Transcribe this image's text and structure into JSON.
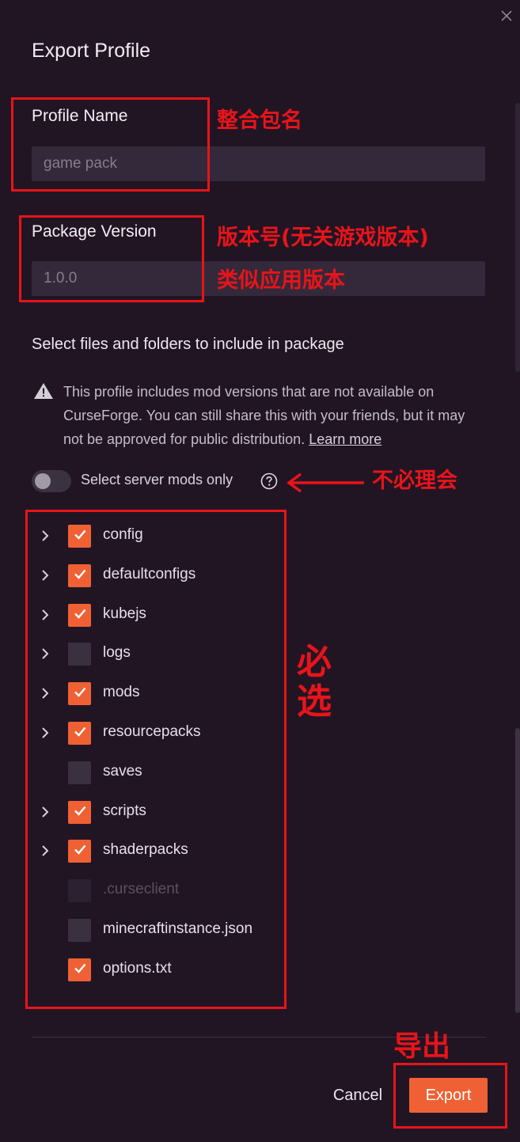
{
  "dialog": {
    "title": "Export Profile",
    "close_icon": "close-icon"
  },
  "profile_name": {
    "label": "Profile Name",
    "value": "",
    "placeholder": "game pack"
  },
  "package_version": {
    "label": "Package Version",
    "value": "",
    "placeholder": "1.0.0"
  },
  "files_section": {
    "heading": "Select files and folders to include in package",
    "warning_icon": "warning-triangle-icon",
    "warning_text": "This profile includes mod versions that are not available on CurseForge. You can still share this with your friends, but it may not be approved for public distribution.",
    "learn_more": "Learn more",
    "server_toggle": {
      "label": "Select server mods only",
      "on": false,
      "help_icon": "help-circle-icon"
    },
    "items": [
      {
        "name": "config",
        "expandable": true,
        "checked": true,
        "disabled": false
      },
      {
        "name": "defaultconfigs",
        "expandable": true,
        "checked": true,
        "disabled": false
      },
      {
        "name": "kubejs",
        "expandable": true,
        "checked": true,
        "disabled": false
      },
      {
        "name": "logs",
        "expandable": true,
        "checked": false,
        "disabled": false
      },
      {
        "name": "mods",
        "expandable": true,
        "checked": true,
        "disabled": false
      },
      {
        "name": "resourcepacks",
        "expandable": true,
        "checked": true,
        "disabled": false
      },
      {
        "name": "saves",
        "expandable": false,
        "checked": false,
        "disabled": false
      },
      {
        "name": "scripts",
        "expandable": true,
        "checked": true,
        "disabled": false
      },
      {
        "name": "shaderpacks",
        "expandable": true,
        "checked": true,
        "disabled": false
      },
      {
        "name": ".curseclient",
        "expandable": false,
        "checked": false,
        "disabled": true
      },
      {
        "name": "minecraftinstance.json",
        "expandable": false,
        "checked": false,
        "disabled": false
      },
      {
        "name": "options.txt",
        "expandable": false,
        "checked": true,
        "disabled": false
      }
    ]
  },
  "footer": {
    "cancel_label": "Cancel",
    "export_label": "Export"
  },
  "annotations": {
    "profile_name_note": "整合包名",
    "version_note_line1": "版本号(无关游戏版本)",
    "version_note_line2": "类似应用版本",
    "toggle_note": "不必理会",
    "files_note": "必选",
    "export_note": "导出"
  },
  "colors": {
    "background": "#211524",
    "input_bg": "#33293a",
    "accent": "#ef6134",
    "annotation_red": "#e8141a"
  }
}
